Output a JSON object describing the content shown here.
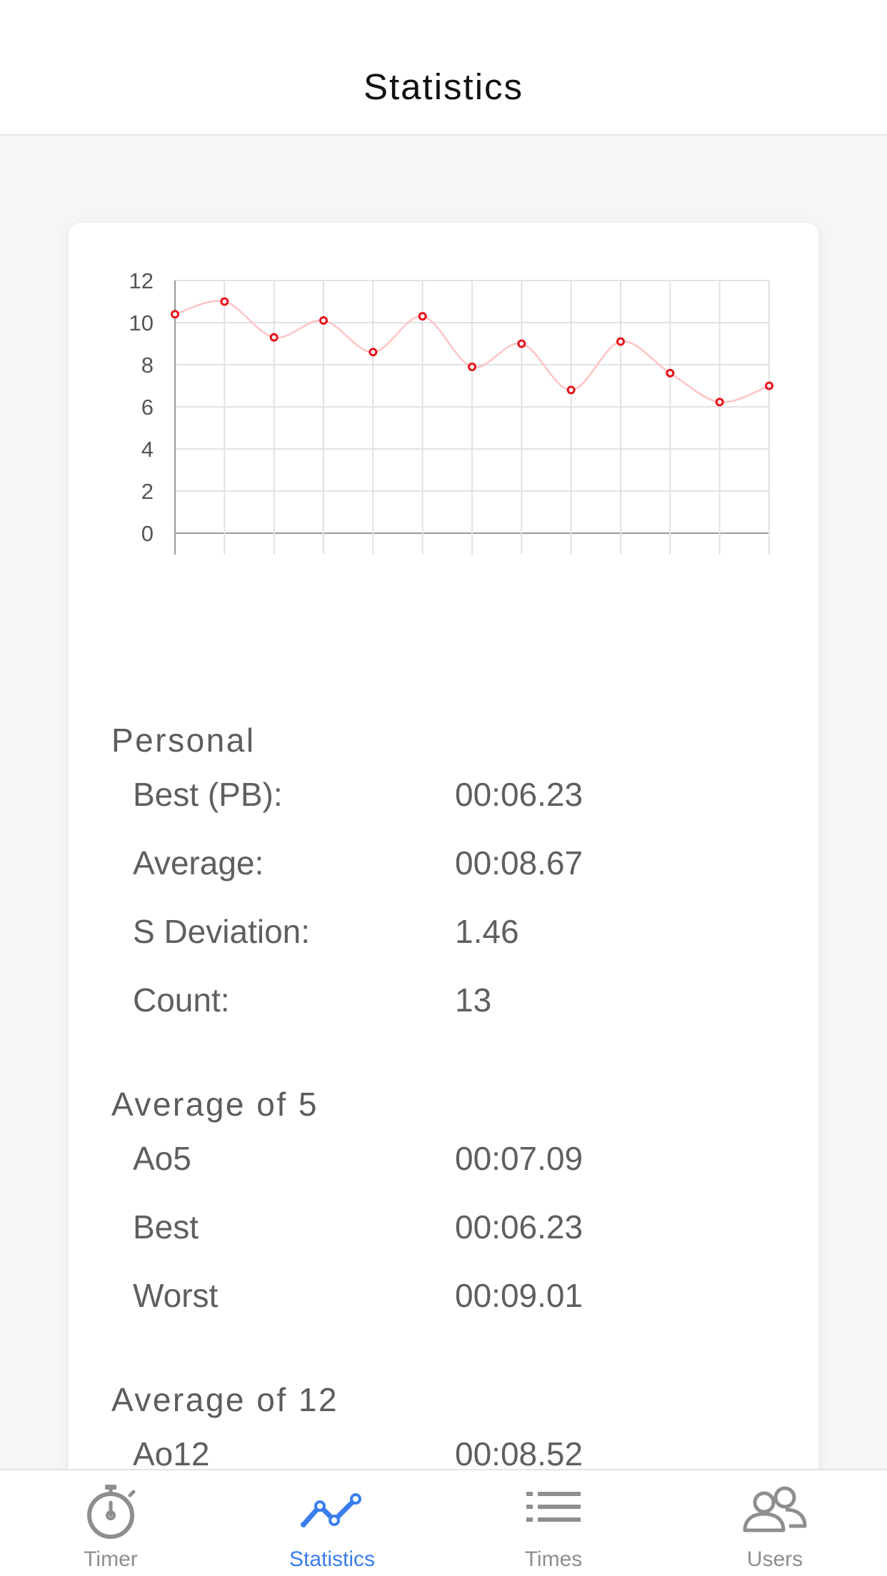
{
  "header": {
    "title": "Statistics"
  },
  "chart_data": {
    "type": "line",
    "x": [
      1,
      2,
      3,
      4,
      5,
      6,
      7,
      8,
      9,
      10,
      11,
      12,
      13
    ],
    "series": [
      {
        "values": [
          10.4,
          11.0,
          9.3,
          10.1,
          8.6,
          10.3,
          7.9,
          9.0,
          6.8,
          9.1,
          7.6,
          6.23,
          7.0
        ]
      }
    ],
    "ylim": [
      0,
      12
    ],
    "yticks": [
      "0",
      "2",
      "4",
      "6",
      "8",
      "10",
      "12"
    ],
    "grid": true,
    "line_color": "#ffc3c3",
    "point_color": "#e8141b",
    "legend": "none"
  },
  "personal": {
    "title": "Personal",
    "rows": [
      {
        "label": "Best (PB):",
        "value": "00:06.23"
      },
      {
        "label": "Average:",
        "value": "00:08.67"
      },
      {
        "label": "S Deviation:",
        "value": "1.46"
      },
      {
        "label": "Count:",
        "value": "13"
      }
    ]
  },
  "ao5": {
    "title": "Average of 5",
    "rows": [
      {
        "label": "Ao5",
        "value": "00:07.09"
      },
      {
        "label": "Best",
        "value": "00:06.23"
      },
      {
        "label": "Worst",
        "value": "00:09.01"
      }
    ]
  },
  "ao12": {
    "title": "Average of 12",
    "rows": [
      {
        "label": "Ao12",
        "value": "00:08.52"
      }
    ]
  },
  "tabs": [
    {
      "label": "Timer",
      "icon": "stopwatch-icon"
    },
    {
      "label": "Statistics",
      "icon": "line-chart-icon"
    },
    {
      "label": "Times",
      "icon": "list-icon"
    },
    {
      "label": "Users",
      "icon": "users-icon"
    }
  ],
  "colors": {
    "accent": "#3b7ded",
    "inactive": "#8e8e8e"
  }
}
